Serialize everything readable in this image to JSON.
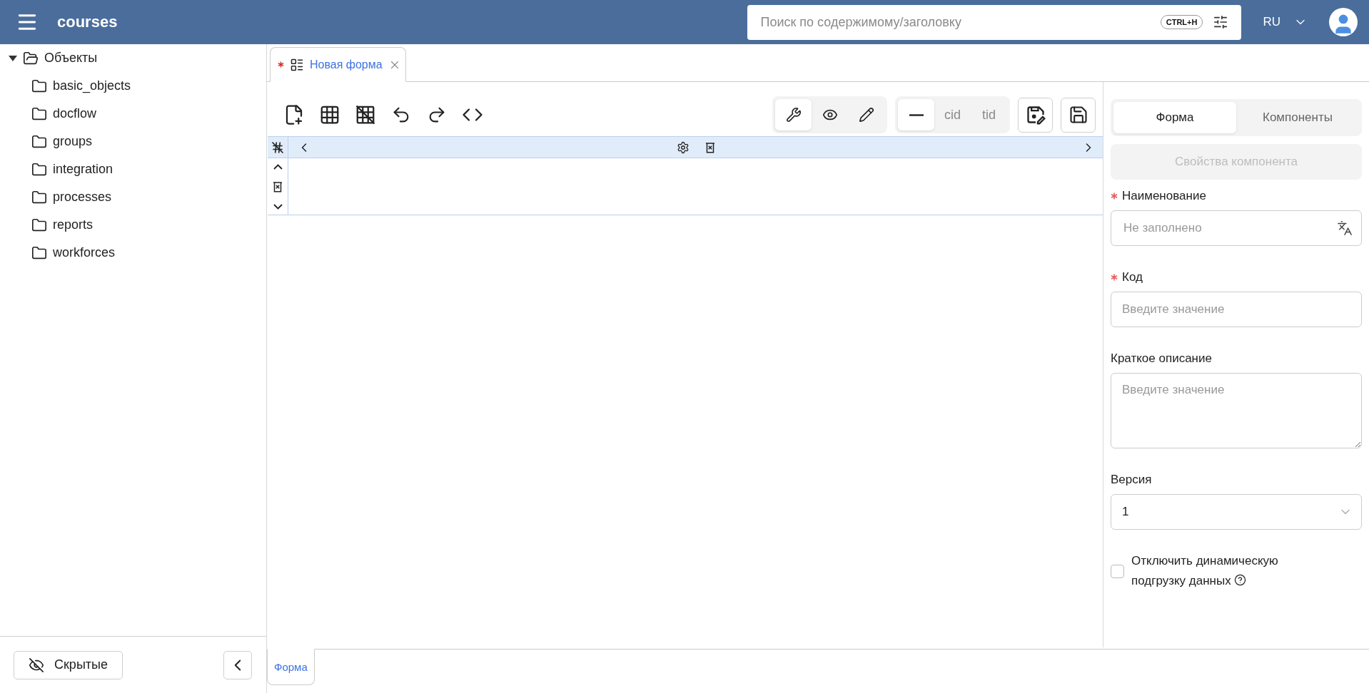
{
  "header": {
    "title": "courses",
    "search": {
      "placeholder": "Поиск по содержимому/заголовку",
      "shortcut": "CTRL+H"
    },
    "language": "RU"
  },
  "sidebar": {
    "tree": [
      {
        "label": "Объекты",
        "expanded": true,
        "children": [
          {
            "label": "basic_objects"
          },
          {
            "label": "docflow"
          },
          {
            "label": "groups"
          },
          {
            "label": "integration"
          },
          {
            "label": "processes"
          },
          {
            "label": "reports"
          },
          {
            "label": "workforces"
          }
        ]
      }
    ],
    "hidden_button": "Скрытые"
  },
  "editor": {
    "tabs": [
      {
        "label": "Новая форма",
        "modified": true,
        "selected": true
      }
    ],
    "view_modes": [
      {
        "selected": true
      },
      {
        "selected": false
      },
      {
        "selected": false
      }
    ],
    "id_modes": [
      {
        "selected": true
      },
      {
        "label": "cid",
        "selected": false
      },
      {
        "label": "tid",
        "selected": false
      }
    ],
    "bottom_tabs": [
      {
        "label": "Форма",
        "selected": true
      }
    ]
  },
  "properties": {
    "tabs": [
      {
        "label": "Форма",
        "selected": true
      },
      {
        "label": "Компоненты",
        "selected": false
      }
    ],
    "component_button": {
      "label": "Свойства компонента",
      "disabled": true
    },
    "fields": [
      {
        "kind": "translatable",
        "label": "Наименование",
        "required": true,
        "placeholder": "Не заполнено"
      },
      {
        "kind": "text",
        "label": "Код",
        "required": true,
        "placeholder": "Введите значение"
      },
      {
        "kind": "textarea",
        "label": "Краткое описание",
        "required": false,
        "placeholder": "Введите значение"
      },
      {
        "kind": "select",
        "label": "Версия",
        "required": false,
        "value": "1"
      }
    ],
    "checkbox": {
      "label": "Отключить динамическую подгрузку данных",
      "checked": false,
      "help": true
    }
  }
}
